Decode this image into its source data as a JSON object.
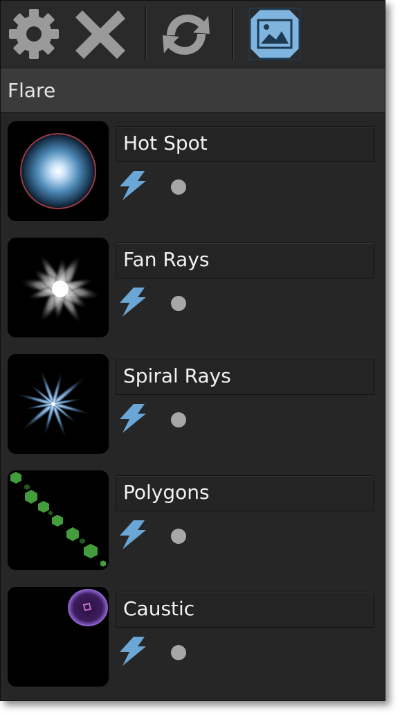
{
  "toolbar": {
    "buttons": [
      {
        "icon": "gear-icon"
      },
      {
        "icon": "close-icon"
      },
      {
        "icon": "refresh-icon"
      },
      {
        "icon": "image-frame-icon"
      }
    ],
    "colors": {
      "icon_gray": "#9a9a9a",
      "accent_blue": "#7fb4df"
    }
  },
  "header": {
    "title": "Flare"
  },
  "layers": [
    {
      "name": "Hot Spot",
      "thumbnail": "hot-spot-thumbnail"
    },
    {
      "name": "Fan Rays",
      "thumbnail": "fan-rays-thumbnail"
    },
    {
      "name": "Spiral Rays",
      "thumbnail": "spiral-rays-thumbnail"
    },
    {
      "name": "Polygons",
      "thumbnail": "polygons-thumbnail"
    },
    {
      "name": "Caustic",
      "thumbnail": "caustic-thumbnail"
    }
  ]
}
